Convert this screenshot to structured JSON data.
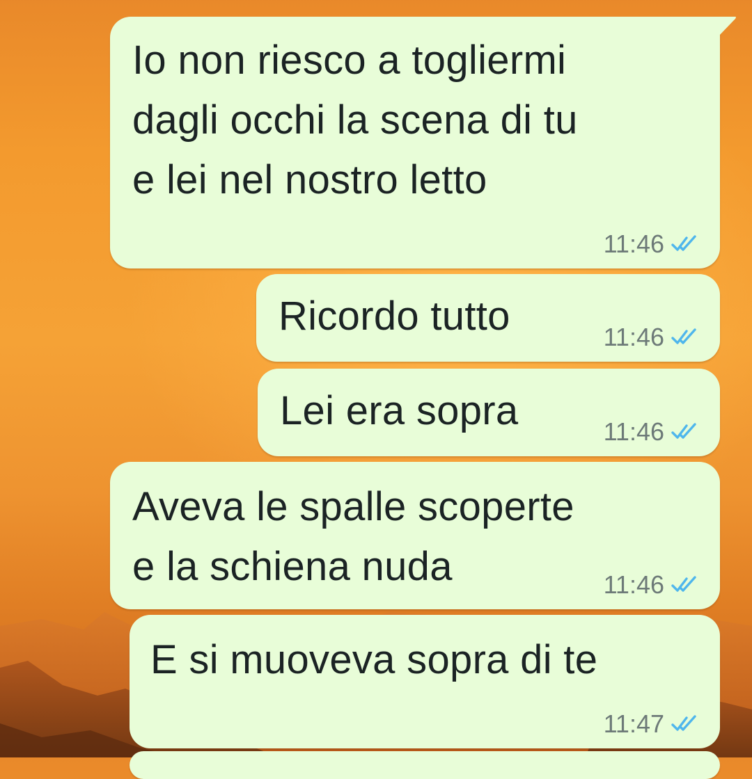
{
  "messages": [
    {
      "text": "Io non riesco a togliermi\ndagli occhi la scena di tu\ne lei nel nostro letto",
      "time": "11:46",
      "status": "read"
    },
    {
      "text": "Ricordo tutto",
      "time": "11:46",
      "status": "read"
    },
    {
      "text": "Lei era sopra",
      "time": "11:46",
      "status": "read"
    },
    {
      "text": "Aveva le spalle scoperte\ne la schiena nuda",
      "time": "11:46",
      "status": "read"
    },
    {
      "text": "E si muoveva sopra di te",
      "time": "11:47",
      "status": "read"
    }
  ],
  "icons": {
    "read_receipt": "double-check-icon"
  },
  "colors": {
    "bubble": "#e8fdd8",
    "read_tick": "#4fb6ec",
    "timestamp": "#6d7a78"
  }
}
